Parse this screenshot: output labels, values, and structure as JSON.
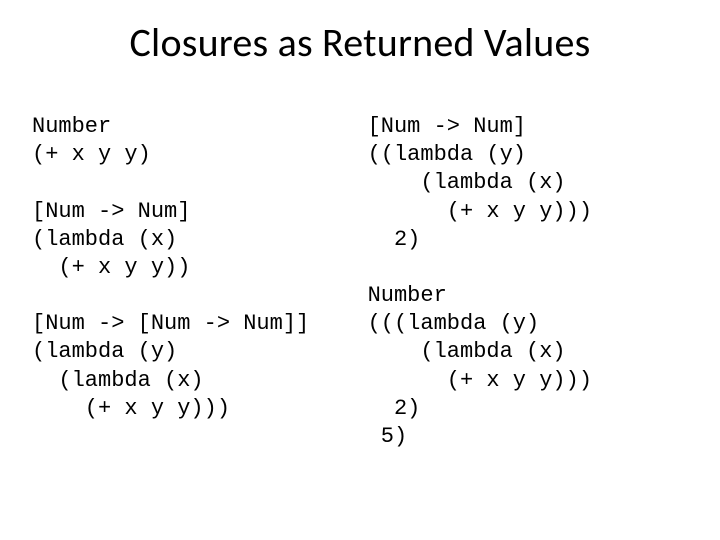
{
  "title": "Closures as Returned Values",
  "left": {
    "block1": "Number\n(+ x y y)",
    "block2": "[Num -> Num]\n(lambda (x)\n  (+ x y y))",
    "block3": "[Num -> [Num -> Num]]\n(lambda (y)\n  (lambda (x)\n    (+ x y y)))"
  },
  "right": {
    "block1": "[Num -> Num]\n((lambda (y)\n    (lambda (x)\n      (+ x y y)))\n  2)",
    "block2": "Number\n(((lambda (y)\n    (lambda (x)\n      (+ x y y)))\n  2)\n 5)"
  }
}
